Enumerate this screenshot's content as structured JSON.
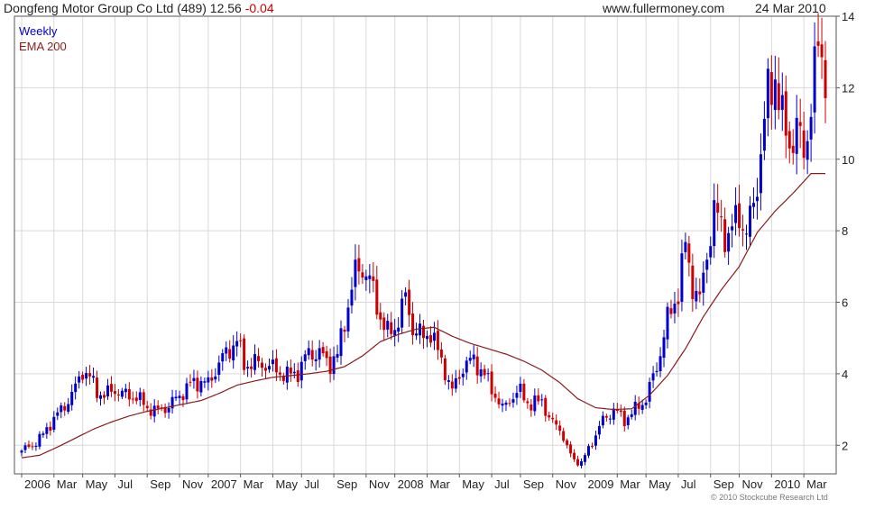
{
  "header": {
    "company": "Dongfeng Motor Group Co Ltd (489) 12.56",
    "change": "-0.04",
    "website": "www.fullermoney.com",
    "date": "24 Mar 2010"
  },
  "legend": {
    "weekly": "Weekly",
    "ema": "EMA 200"
  },
  "copyright": "© 2010 Stockcube Research Ltd",
  "colors": {
    "up": "#0000cc",
    "down": "#cc0000",
    "ema": "#8b1a1a",
    "grid": "#d9d9d9",
    "frame": "#555555",
    "text": "#222222"
  },
  "chart_data": {
    "type": "candlestick",
    "title": "Dongfeng Motor Group Co Ltd (489) 12.56 -0.04",
    "ylim": [
      1.2,
      14
    ],
    "yticks": [
      2,
      4,
      6,
      8,
      10,
      12,
      14
    ],
    "xlim": [
      0,
      225
    ],
    "x_tick_positions": [
      0,
      9,
      17,
      26,
      35,
      44,
      52,
      61,
      70,
      78,
      87,
      96,
      104,
      113,
      122,
      131,
      139,
      148,
      157,
      166,
      174,
      183,
      192,
      200,
      209,
      218
    ],
    "x_tick_labels": [
      "2006",
      "Mar",
      "May",
      "Jul",
      "Sep",
      "Nov",
      "2007",
      "Mar",
      "May",
      "Jul",
      "Sep",
      "Nov",
      "2008",
      "Mar",
      "May",
      "Jul",
      "Sep",
      "Nov",
      "2009",
      "Mar",
      "May",
      "Jul",
      "Sep",
      "Nov",
      "2010",
      "Mar"
    ],
    "series": [
      {
        "name": "Weekly",
        "type": "candlestick"
      },
      {
        "name": "EMA 200",
        "type": "line"
      }
    ],
    "ema_anchors": [
      [
        0,
        1.65
      ],
      [
        5,
        1.72
      ],
      [
        10,
        1.95
      ],
      [
        15,
        2.2
      ],
      [
        20,
        2.45
      ],
      [
        25,
        2.65
      ],
      [
        30,
        2.82
      ],
      [
        35,
        2.95
      ],
      [
        40,
        3.05
      ],
      [
        45,
        3.15
      ],
      [
        50,
        3.25
      ],
      [
        55,
        3.45
      ],
      [
        60,
        3.68
      ],
      [
        65,
        3.8
      ],
      [
        70,
        3.9
      ],
      [
        75,
        3.95
      ],
      [
        80,
        4.0
      ],
      [
        85,
        4.07
      ],
      [
        90,
        4.2
      ],
      [
        95,
        4.5
      ],
      [
        100,
        4.9
      ],
      [
        105,
        5.1
      ],
      [
        110,
        5.25
      ],
      [
        115,
        5.3
      ],
      [
        120,
        5.05
      ],
      [
        125,
        4.85
      ],
      [
        130,
        4.7
      ],
      [
        135,
        4.55
      ],
      [
        140,
        4.35
      ],
      [
        145,
        4.1
      ],
      [
        150,
        3.75
      ],
      [
        155,
        3.3
      ],
      [
        160,
        3.05
      ],
      [
        165,
        3.0
      ],
      [
        170,
        3.02
      ],
      [
        175,
        3.4
      ],
      [
        180,
        3.95
      ],
      [
        185,
        4.7
      ],
      [
        190,
        5.6
      ],
      [
        195,
        6.35
      ],
      [
        200,
        7.0
      ],
      [
        205,
        7.95
      ],
      [
        210,
        8.55
      ],
      [
        215,
        9.05
      ],
      [
        220,
        9.6
      ]
    ],
    "close_anchors": [
      [
        0,
        1.85
      ],
      [
        3,
        2.0
      ],
      [
        6,
        2.3
      ],
      [
        9,
        2.75
      ],
      [
        12,
        3.1
      ],
      [
        15,
        3.6
      ],
      [
        17,
        4.1
      ],
      [
        19,
        3.9
      ],
      [
        21,
        3.5
      ],
      [
        23,
        3.4
      ],
      [
        26,
        3.55
      ],
      [
        29,
        3.4
      ],
      [
        32,
        3.35
      ],
      [
        35,
        3.05
      ],
      [
        38,
        2.95
      ],
      [
        41,
        3.1
      ],
      [
        44,
        3.4
      ],
      [
        47,
        3.7
      ],
      [
        50,
        3.8
      ],
      [
        52,
        3.7
      ],
      [
        55,
        4.3
      ],
      [
        58,
        4.7
      ],
      [
        60,
        4.95
      ],
      [
        62,
        4.25
      ],
      [
        65,
        4.3
      ],
      [
        68,
        4.25
      ],
      [
        71,
        4.1
      ],
      [
        74,
        3.95
      ],
      [
        77,
        4.05
      ],
      [
        80,
        4.6
      ],
      [
        83,
        4.55
      ],
      [
        86,
        4.3
      ],
      [
        88,
        4.5
      ],
      [
        90,
        5.5
      ],
      [
        93,
        6.8
      ],
      [
        95,
        7.0
      ],
      [
        97,
        6.6
      ],
      [
        100,
        5.6
      ],
      [
        102,
        5.1
      ],
      [
        104,
        5.3
      ],
      [
        107,
        6.1
      ],
      [
        109,
        5.3
      ],
      [
        112,
        5.0
      ],
      [
        114,
        5.2
      ],
      [
        116,
        4.6
      ],
      [
        118,
        4.1
      ],
      [
        120,
        3.5
      ],
      [
        123,
        4.2
      ],
      [
        126,
        4.4
      ],
      [
        129,
        3.95
      ],
      [
        132,
        3.4
      ],
      [
        134,
        3.0
      ],
      [
        136,
        3.3
      ],
      [
        139,
        3.5
      ],
      [
        142,
        3.1
      ],
      [
        145,
        3.3
      ],
      [
        147,
        2.7
      ],
      [
        150,
        2.5
      ],
      [
        152,
        1.9
      ],
      [
        154,
        1.6
      ],
      [
        156,
        1.5
      ],
      [
        158,
        1.9
      ],
      [
        160,
        2.3
      ],
      [
        162,
        2.7
      ],
      [
        165,
        3.0
      ],
      [
        168,
        2.7
      ],
      [
        171,
        3.0
      ],
      [
        174,
        3.3
      ],
      [
        177,
        4.2
      ],
      [
        180,
        5.5
      ],
      [
        183,
        6.3
      ],
      [
        185,
        7.6
      ],
      [
        187,
        6.5
      ],
      [
        189,
        6.0
      ],
      [
        191,
        7.4
      ],
      [
        193,
        8.5
      ],
      [
        195,
        8.2
      ],
      [
        197,
        7.8
      ],
      [
        200,
        8.5
      ],
      [
        202,
        7.9
      ],
      [
        204,
        8.7
      ],
      [
        206,
        10.2
      ],
      [
        208,
        11.8
      ],
      [
        210,
        12.4
      ],
      [
        212,
        11.0
      ],
      [
        214,
        10.5
      ],
      [
        216,
        10.8
      ],
      [
        218,
        10.2
      ],
      [
        220,
        11.5
      ],
      [
        222,
        13.2
      ],
      [
        224,
        12.56
      ]
    ]
  }
}
